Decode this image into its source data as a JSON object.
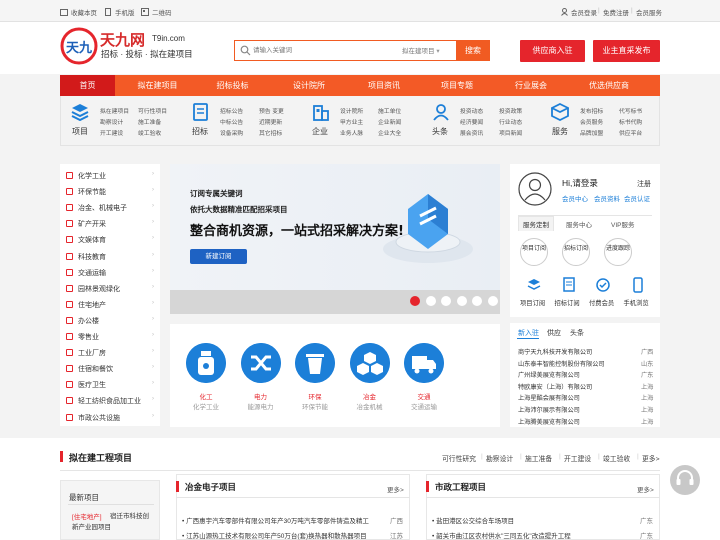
{
  "topbar": {
    "favorite": "收藏本页",
    "mobile": "手机版",
    "qrcode": "二维码",
    "login": "会员登录",
    "register": "免费注册",
    "service": "会员服务",
    "sep": "|"
  },
  "logo": {
    "cn": "天九网",
    "en": "T9in.com",
    "slogan": "招标 · 投标 · 拟在建项目",
    "mark": "天九"
  },
  "search": {
    "placeholder": "请输入关键词",
    "scope": "拟在建项目",
    "button": "搜索"
  },
  "actions": {
    "supplier": "供应商入驻",
    "owner": "业主直采发布"
  },
  "nav": [
    "首页",
    "拟在建项目",
    "招标投标",
    "设计院所",
    "项目资讯",
    "项目专题",
    "行业展会",
    "优选供应商"
  ],
  "subnav": [
    {
      "label": "项目",
      "icon": "project-icon",
      "links": [
        "拟在建项目",
        "可行性项目",
        "勘察设计",
        "施工准备",
        "开工建设",
        "竣工验收"
      ]
    },
    {
      "label": "招标",
      "icon": "bidding-icon",
      "links": [
        "招标公告",
        "预告 变更",
        "中标公告",
        "近期更新",
        "设备采购",
        "其它招标"
      ]
    },
    {
      "label": "企业",
      "icon": "enterprise-icon",
      "links": [
        "设计院所",
        "施工单位",
        "甲方业主",
        "企业新闻",
        "业务人脉",
        "企业大全"
      ]
    },
    {
      "label": "头条",
      "icon": "headline-icon",
      "links": [
        "投资动态",
        "投资政策",
        "经济要闻",
        "行业动态",
        "展会资讯",
        "项目新闻"
      ]
    },
    {
      "label": "服务",
      "icon": "service-icon",
      "links": [
        "发布招标",
        "代写标书",
        "会员服务",
        "标书代购",
        "品牌加盟",
        "供应平台"
      ]
    }
  ],
  "categories": [
    "化学工业",
    "环保节能",
    "冶金、机械电子",
    "矿产开采",
    "文娱体育",
    "科技教育",
    "交通运输",
    "园林景观绿化",
    "住宅地产",
    "办公楼",
    "零售业",
    "工业厂房",
    "住宿和餐饮",
    "医疗卫生",
    "轻工纺织食品加工业",
    "市政公共设施"
  ],
  "banner": {
    "line1": "订阅专属关键词",
    "line2": "依托大数据精准匹配招采项目",
    "headline": "整合商机资源，一站式招采解决方案!",
    "button": "新建订阅",
    "slides": 6,
    "active_slide": 1
  },
  "industries": [
    {
      "name": "化工",
      "sub": "化学工业",
      "icon": "chemical-bottle-icon"
    },
    {
      "name": "电力",
      "sub": "能源电力",
      "icon": "power-shuffle-icon"
    },
    {
      "name": "环保",
      "sub": "环保节能",
      "icon": "trash-bin-icon"
    },
    {
      "name": "冶金",
      "sub": "冶金机械",
      "icon": "cubes-icon"
    },
    {
      "name": "交通",
      "sub": "交通运输",
      "icon": "truck-icon"
    }
  ],
  "user": {
    "greeting": "Hi,请登录",
    "register": "注册",
    "links": [
      "会员中心",
      "会员资料",
      "会员认证"
    ],
    "tabs": [
      "服务定制",
      "服务中心",
      "VIP服务"
    ],
    "circles": [
      "项目订阅",
      "招标订阅",
      "进度跟踪"
    ],
    "tools": [
      "项目订阅",
      "招标订阅",
      "付费会员",
      "手机浏览"
    ]
  },
  "news": {
    "tabs": [
      "新入驻",
      "供应",
      "头条"
    ],
    "items": [
      {
        "name": "商宁天九科技开发有限公司",
        "region": "广西"
      },
      {
        "name": "山东泰丰智能控制股份有限公司",
        "region": "山东"
      },
      {
        "name": "广州绿美展览有限公司",
        "region": "广东"
      },
      {
        "name": "特欧康安（上海）有限公司",
        "region": "上海"
      },
      {
        "name": "上海星酷会展有限公司",
        "region": "上海"
      },
      {
        "name": "上海沛尔展示有限公司",
        "region": "上海"
      },
      {
        "name": "上海腾美展览有限公司",
        "region": "上海"
      }
    ]
  },
  "projects": {
    "title": "拟在建工程项目",
    "stages": [
      "可行性研究",
      "勘察设计",
      "施工准备",
      "开工建设",
      "竣工验收",
      "更多>"
    ],
    "latest_title": "最新项目",
    "latest_item_tag": "[住宅地产]",
    "latest_item": "宿迁市科技创新产业园项目",
    "col1": {
      "title": "冶金电子项目",
      "more": "更多>",
      "items": [
        {
          "name": "广西惠宇汽车零部件有限公司年产30万吨汽车零部件铸造及精工",
          "region": "广西"
        },
        {
          "name": "江苏山源热工技术有限公司年产50万台(套)换热器和散热器项目",
          "region": "江苏"
        }
      ]
    },
    "col2": {
      "title": "市政工程项目",
      "more": "更多>",
      "items": [
        {
          "name": "盐田港区公交综合车场项目",
          "region": "广东"
        },
        {
          "name": "韶关市曲江区农村供水\"三同五化\"改造提升工程",
          "region": "广东"
        }
      ]
    }
  },
  "colors": {
    "brand_red": "#e5252c",
    "nav_orange": "#f35a26",
    "accent_blue": "#1c7fd8"
  }
}
